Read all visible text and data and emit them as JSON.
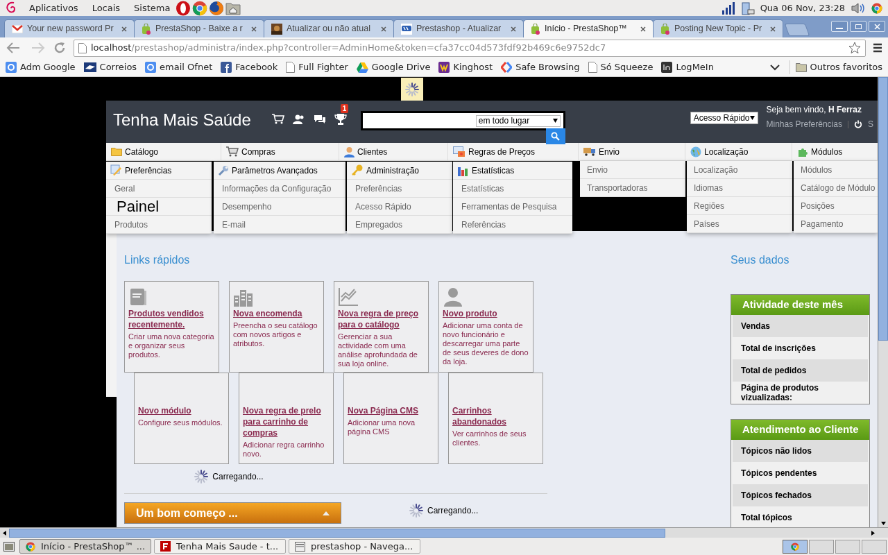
{
  "desktop_panel": {
    "menus": [
      "Aplicativos",
      "Locais",
      "Sistema"
    ],
    "clock": "Qua 06 Nov, 23:28"
  },
  "tabs": [
    {
      "title": "Your new password Pr",
      "kind": "mail",
      "selected": false
    },
    {
      "title": "PrestaShop - Baixe a r",
      "kind": "bag",
      "selected": false
    },
    {
      "title": "Atualizar ou não atual",
      "kind": "photo",
      "selected": false
    },
    {
      "title": "Prestashop - Atualizar",
      "kind": "site",
      "selected": false
    },
    {
      "title": "Início - PrestaShop™",
      "kind": "bag",
      "selected": true
    },
    {
      "title": "Posting New Topic - Pr",
      "kind": "bag",
      "selected": false
    }
  ],
  "address": {
    "host": "localhost",
    "path": "/prestashop/administra/index.php?controller=AdminHome&token=cfa37cc04d573fdf92b469c6e9752dc7"
  },
  "bookmarks": [
    {
      "label": "Adm Google",
      "kind": "google"
    },
    {
      "label": "Correios",
      "kind": "mailbird"
    },
    {
      "label": "email Ofnet",
      "kind": "google"
    },
    {
      "label": "Facebook",
      "kind": "facebook"
    },
    {
      "label": "Full Fighter",
      "kind": "page"
    },
    {
      "label": "Google Drive",
      "kind": "drive"
    },
    {
      "label": "Kinghost",
      "kind": "kinghost"
    },
    {
      "label": "Safe Browsing",
      "kind": "safe"
    },
    {
      "label": "Só Squeeze",
      "kind": "page"
    },
    {
      "label": "LogMeIn",
      "kind": "logmein"
    }
  ],
  "other_bookmarks": "Outros favoritos",
  "shop": {
    "name": "Tenha Mais Saúde",
    "notifications": "1",
    "search_scope": "em todo lugar",
    "quick_access": "Acesso Rápido",
    "welcome": "Seja bem vindo,",
    "user": "H Ferraz",
    "preferences": "Minhas Preferências",
    "logout": "S"
  },
  "menu": [
    {
      "label": "Catálogo",
      "kind": "folder"
    },
    {
      "label": "Compras",
      "kind": "cart"
    },
    {
      "label": "Clientes",
      "kind": "person"
    },
    {
      "label": "Regras de Preços",
      "kind": "card"
    },
    {
      "label": "Envio",
      "kind": "truck"
    },
    {
      "label": "Localização",
      "kind": "globe"
    },
    {
      "label": "Módulos",
      "kind": "puzzle"
    }
  ],
  "open_menus": [
    {
      "label": "Preferências",
      "kind": "pencil",
      "items": [
        "Geral",
        "Produtos"
      ]
    },
    {
      "label": "Parâmetros Avançados",
      "kind": "wrench",
      "items": [
        "Informações da Configuração",
        "Desempenho",
        "E-mail"
      ]
    },
    {
      "label": "Administração",
      "kind": "key",
      "items": [
        "Preferências",
        "Acesso Rápido",
        "Empregados"
      ]
    },
    {
      "label": "Estatísticas",
      "kind": "bars",
      "items": [
        "Estatísticas",
        "Ferramentas de Pesquisa",
        "Referências"
      ]
    }
  ],
  "submenus": [
    {
      "items": [
        "Envio",
        "Transportadoras"
      ]
    },
    {
      "items": [
        "Localização",
        "Idiomas",
        "Regiões",
        "Países"
      ]
    },
    {
      "items": [
        "Módulos",
        "Catálogo de Módulo",
        "Posições",
        "Pagamento"
      ]
    }
  ],
  "page_title": "Painel",
  "quick_links": {
    "title": "Links rápidos",
    "rows": [
      [
        {
          "title": "Produtos vendidos recentemente.",
          "description": "Criar uma nova categoria e organizar seus produtos.",
          "kind": "book"
        },
        {
          "title": "Nova encomenda",
          "description": "Preencha o seu catálogo com novos artigos e atributos.",
          "kind": "buildings"
        },
        {
          "title": "Nova regra de preço para o catálogo",
          "description": "Gerenciar a sua actividade com uma análise aprofundada de sua loja online.",
          "kind": "chart"
        },
        {
          "title": "Novo produto",
          "description": "Adicionar uma conta de novo funcionário e descarregar uma parte de seus deveres de dono da loja.",
          "kind": "person"
        }
      ],
      [
        {
          "title": "Novo módulo",
          "description": "Configure seus módulos.",
          "kind": "plain"
        },
        {
          "title": "Nova regra de prelo para carrinho de compras",
          "description": "Adicionar regra carrinho novo.",
          "kind": "plain"
        },
        {
          "title": "Nova Página CMS",
          "description": "Adicionar uma nova página CMS",
          "kind": "plain"
        },
        {
          "title": "Carrinhos abandonados",
          "description": "Ver carrinhos de seus clientes.",
          "kind": "plain"
        }
      ]
    ]
  },
  "loading": [
    "Carregando...",
    "Carregando..."
  ],
  "good_start": {
    "title": "Um bom começo ..."
  },
  "your_data": {
    "title": "Seus dados",
    "panels": [
      {
        "title": "Atividade deste mês",
        "rows": [
          "Vendas",
          "Total de inscrições",
          "Total de pedidos",
          "Página de produtos vizualizadas:"
        ]
      },
      {
        "title": "Atendimento ao Cliente",
        "rows": [
          "Tópicos não lidos",
          "Tópicos pendentes",
          "Tópicos fechados",
          "Total tópicos"
        ]
      }
    ]
  },
  "taskbar": [
    {
      "title": "Início - PrestaShop™ ...",
      "kind": "chrome",
      "selected": true
    },
    {
      "title": "Tenha Mais Saude - t...",
      "kind": "filezilla",
      "selected": false
    },
    {
      "title": "prestashop - Navega...",
      "kind": "files",
      "selected": false
    }
  ]
}
